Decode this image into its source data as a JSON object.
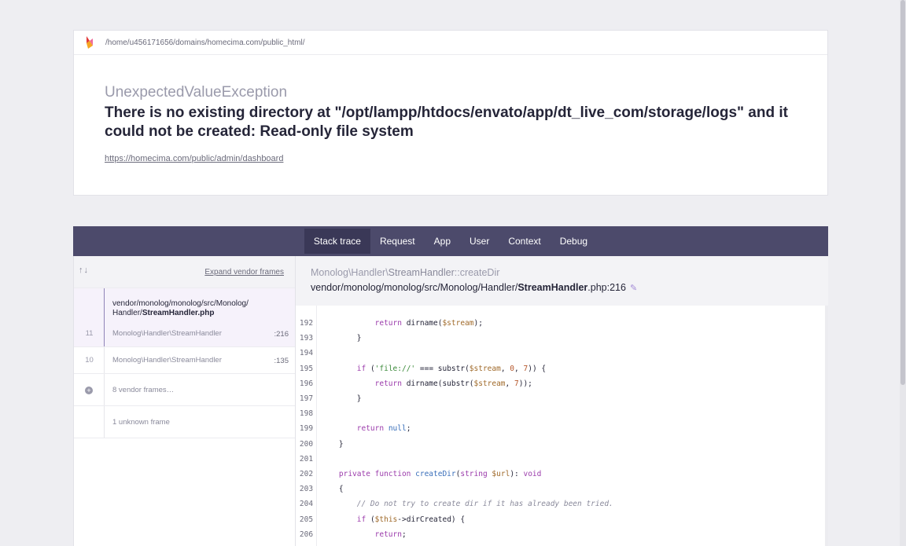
{
  "header": {
    "path": "/home/u456171656/domains/homecima.com/public_html/",
    "exception_class": "UnexpectedValueException",
    "message": "There is no existing directory at \"/opt/lampp/htdocs/envato/app/dt_live_com/storage/logs\" and it could not be created: Read-only file system",
    "url": "https://homecima.com/public/admin/dashboard"
  },
  "tabs": [
    {
      "label": "Stack trace",
      "active": true
    },
    {
      "label": "Request"
    },
    {
      "label": "App"
    },
    {
      "label": "User"
    },
    {
      "label": "Context"
    },
    {
      "label": "Debug"
    }
  ],
  "frames_panel": {
    "arrows": "↑↓",
    "expand_label": "Expand vendor frames",
    "selected_file": "vendor/monolog/monolog/src/Monolog/Handler/StreamHandler.php",
    "selected_file_line1": "vendor/monolog/monolog/src/Monolog/",
    "selected_file_line2_plain": "Handler/",
    "selected_file_line2_bold": "StreamHandler.php",
    "frames": [
      {
        "num": "11",
        "class": "Monolog\\Handler\\StreamHandler",
        "line": ":216"
      },
      {
        "num": "10",
        "class": "Monolog\\Handler\\StreamHandler",
        "line": ":135"
      }
    ],
    "vendor_frames_label": "8 vendor frames…",
    "unknown_frame_label": "1 unknown frame"
  },
  "code_header": {
    "class_prefix": "Monolog\\Handler\\",
    "class_name": "StreamHandler",
    "method": "::createDir",
    "file_prefix": "vendor/monolog/monolog/src/Monolog/Handler/",
    "file_name": "StreamHandler",
    "file_suffix": ".php:216"
  },
  "code_lines": [
    {
      "num": "192",
      "html": "            <span class='kw'>return</span> dirname(<span class='var'>$stream</span>);"
    },
    {
      "num": "193",
      "html": "        }"
    },
    {
      "num": "194",
      "html": ""
    },
    {
      "num": "195",
      "html": "        <span class='kw'>if</span> (<span class='str'>'file://'</span> === substr(<span class='var'>$stream</span>, <span class='num'>0</span>, <span class='num'>7</span>)) {"
    },
    {
      "num": "196",
      "html": "            <span class='kw'>return</span> dirname(substr(<span class='var'>$stream</span>, <span class='num'>7</span>));"
    },
    {
      "num": "197",
      "html": "        }"
    },
    {
      "num": "198",
      "html": ""
    },
    {
      "num": "199",
      "html": "        <span class='kw'>return</span> <span class='fn'>null</span>;"
    },
    {
      "num": "200",
      "html": "    }"
    },
    {
      "num": "201",
      "html": ""
    },
    {
      "num": "202",
      "html": "    <span class='kw'>private function</span> <span class='fn'>createDir</span>(<span class='kw'>string</span> <span class='var'>$url</span>): <span class='kw'>void</span>"
    },
    {
      "num": "203",
      "html": "    {"
    },
    {
      "num": "204",
      "html": "        <span class='cmt'>// Do not try to create dir if it has already been tried.</span>"
    },
    {
      "num": "205",
      "html": "        <span class='kw'>if</span> (<span class='var'>$this</span>-&gt;dirCreated) {"
    },
    {
      "num": "206",
      "html": "            <span class='kw'>return</span>;"
    }
  ]
}
